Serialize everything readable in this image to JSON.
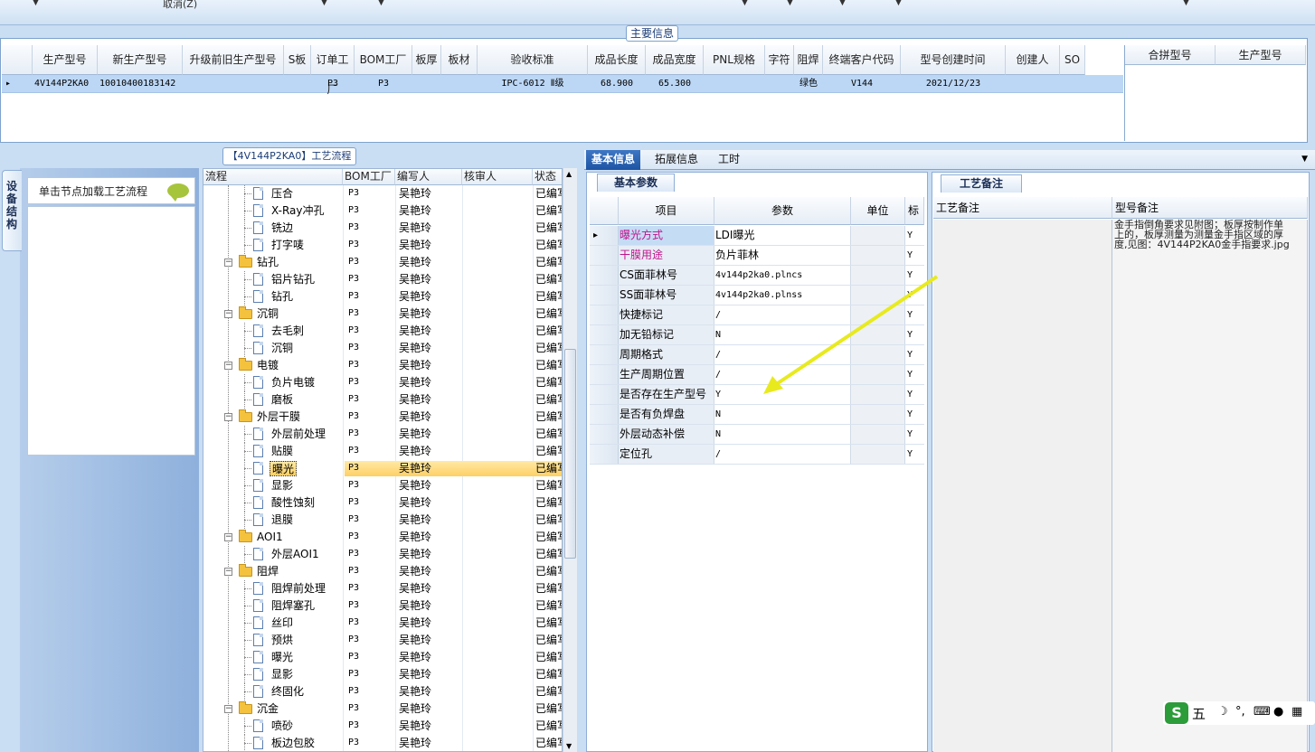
{
  "toolbar": {
    "cancel_label": "取消(Z)"
  },
  "main_info": {
    "legend": "主要信息",
    "columns": [
      "生产型号",
      "新生产型号",
      "升级前旧生产型号",
      "S板",
      "订单工厂",
      "BOM工厂",
      "板厚",
      "板材",
      "验收标准",
      "成品长度",
      "成品宽度",
      "PNL规格",
      "字符",
      "阻焊",
      "终端客户代码",
      "型号创建时间",
      "创建人",
      "SO"
    ],
    "row": [
      "4V144P2KA0",
      "10010400183142",
      "",
      "",
      "P3",
      "P3",
      "",
      "",
      "IPC-6012 Ⅱ级",
      "68.900",
      "65.300",
      "",
      "",
      "绿色",
      "V144",
      "2021/12/23",
      "",
      ""
    ]
  },
  "merge_grid": {
    "columns": [
      "合拼型号",
      "生产型号"
    ]
  },
  "side": {
    "vtab_label": "设备结构",
    "load_hint": "单击节点加载工艺流程"
  },
  "flow": {
    "title": "【4V144P2KA0】工艺流程",
    "columns": [
      "流程",
      "BOM工厂",
      "编写人",
      "核审人",
      "状态"
    ],
    "rows": [
      {
        "name": "压合",
        "type": "file",
        "bom": "P3",
        "writer": "吴艳玲",
        "status": "已编写"
      },
      {
        "name": "X-Ray冲孔",
        "type": "file",
        "bom": "P3",
        "writer": "吴艳玲",
        "status": "已编写"
      },
      {
        "name": "铣边",
        "type": "file",
        "bom": "P3",
        "writer": "吴艳玲",
        "status": "已编写"
      },
      {
        "name": "打字唛",
        "type": "file",
        "bom": "P3",
        "writer": "吴艳玲",
        "status": "已编写"
      },
      {
        "name": "钻孔",
        "type": "folder",
        "bom": "P3",
        "writer": "吴艳玲",
        "status": "已编写"
      },
      {
        "name": "铝片钻孔",
        "type": "file",
        "bom": "P3",
        "writer": "吴艳玲",
        "status": "已编写"
      },
      {
        "name": "钻孔",
        "type": "file",
        "bom": "P3",
        "writer": "吴艳玲",
        "status": "已编写"
      },
      {
        "name": "沉铜",
        "type": "folder",
        "bom": "P3",
        "writer": "吴艳玲",
        "status": "已编写"
      },
      {
        "name": "去毛刺",
        "type": "file",
        "bom": "P3",
        "writer": "吴艳玲",
        "status": "已编写"
      },
      {
        "name": "沉铜",
        "type": "file",
        "bom": "P3",
        "writer": "吴艳玲",
        "status": "已编写"
      },
      {
        "name": "电镀",
        "type": "folder",
        "bom": "P3",
        "writer": "吴艳玲",
        "status": "已编写"
      },
      {
        "name": "负片电镀",
        "type": "file",
        "bom": "P3",
        "writer": "吴艳玲",
        "status": "已编写"
      },
      {
        "name": "磨板",
        "type": "file",
        "bom": "P3",
        "writer": "吴艳玲",
        "status": "已编写"
      },
      {
        "name": "外层干膜",
        "type": "folder",
        "bom": "P3",
        "writer": "吴艳玲",
        "status": "已编写"
      },
      {
        "name": "外层前处理",
        "type": "file",
        "bom": "P3",
        "writer": "吴艳玲",
        "status": "已编写"
      },
      {
        "name": "贴膜",
        "type": "file",
        "bom": "P3",
        "writer": "吴艳玲",
        "status": "已编写"
      },
      {
        "name": "曝光",
        "type": "file",
        "bom": "P3",
        "writer": "吴艳玲",
        "status": "已编写",
        "selected": true
      },
      {
        "name": "显影",
        "type": "file",
        "bom": "P3",
        "writer": "吴艳玲",
        "status": "已编写"
      },
      {
        "name": "酸性蚀刻",
        "type": "file",
        "bom": "P3",
        "writer": "吴艳玲",
        "status": "已编写"
      },
      {
        "name": "退膜",
        "type": "file",
        "bom": "P3",
        "writer": "吴艳玲",
        "status": "已编写"
      },
      {
        "name": "AOI1",
        "type": "folder",
        "bom": "P3",
        "writer": "吴艳玲",
        "status": "已编写"
      },
      {
        "name": "外层AOI1",
        "type": "file",
        "bom": "P3",
        "writer": "吴艳玲",
        "status": "已编写"
      },
      {
        "name": "阻焊",
        "type": "folder",
        "bom": "P3",
        "writer": "吴艳玲",
        "status": "已编写"
      },
      {
        "name": "阻焊前处理",
        "type": "file",
        "bom": "P3",
        "writer": "吴艳玲",
        "status": "已编写"
      },
      {
        "name": "阻焊塞孔",
        "type": "file",
        "bom": "P3",
        "writer": "吴艳玲",
        "status": "已编写"
      },
      {
        "name": "丝印",
        "type": "file",
        "bom": "P3",
        "writer": "吴艳玲",
        "status": "已编写"
      },
      {
        "name": "预烘",
        "type": "file",
        "bom": "P3",
        "writer": "吴艳玲",
        "status": "已编写"
      },
      {
        "name": "曝光",
        "type": "file",
        "bom": "P3",
        "writer": "吴艳玲",
        "status": "已编写"
      },
      {
        "name": "显影",
        "type": "file",
        "bom": "P3",
        "writer": "吴艳玲",
        "status": "已编写"
      },
      {
        "name": "终固化",
        "type": "file",
        "bom": "P3",
        "writer": "吴艳玲",
        "status": "已编写"
      },
      {
        "name": "沉金",
        "type": "folder",
        "bom": "P3",
        "writer": "吴艳玲",
        "status": "已编写"
      },
      {
        "name": "喷砂",
        "type": "file",
        "bom": "P3",
        "writer": "吴艳玲",
        "status": "已编写"
      },
      {
        "name": "板边包胶",
        "type": "file",
        "bom": "P3",
        "writer": "吴艳玲",
        "status": "已编写"
      }
    ]
  },
  "right_tabs": [
    "基本信息",
    "拓展信息",
    "工时"
  ],
  "basic": {
    "tab_label": "基本参数",
    "columns": [
      "项目",
      "参数",
      "单位",
      "标"
    ],
    "rows": [
      {
        "item": "曝光方式",
        "param": "LDI曝光",
        "flag": "Y",
        "highlight": true
      },
      {
        "item": "干膜用途",
        "param": "负片菲林",
        "flag": "Y",
        "highlight": true
      },
      {
        "item": "CS面菲林号",
        "param": "4v144p2ka0.plncs",
        "flag": "Y"
      },
      {
        "item": "SS面菲林号",
        "param": "4v144p2ka0.plnss",
        "flag": "Y"
      },
      {
        "item": "快捷标记",
        "param": "/",
        "flag": "Y"
      },
      {
        "item": "加无铅标记",
        "param": "N",
        "flag": "Y"
      },
      {
        "item": "周期格式",
        "param": "/",
        "flag": "Y"
      },
      {
        "item": "生产周期位置",
        "param": "/",
        "flag": "Y"
      },
      {
        "item": "是否存在生产型号",
        "param": "Y",
        "flag": "Y"
      },
      {
        "item": "是否有负焊盘",
        "param": "N",
        "flag": "Y"
      },
      {
        "item": "外层动态补偿",
        "param": "N",
        "flag": "Y"
      },
      {
        "item": "定位孔",
        "param": "/",
        "flag": "Y"
      }
    ]
  },
  "notes": {
    "tab_label": "工艺备注",
    "col_process": "工艺备注",
    "col_model": "型号备注",
    "model_note": "金手指倒角要求见附图；板厚按制作单上的，板厚测量为测量金手指区域的厚度,见图：4V144P2KA0金手指要求.jpg"
  },
  "ime": {
    "label": "五"
  },
  "colors": {
    "accent": "#1d54a3",
    "highlight_text": "#c0148c",
    "selection": "#fdd065",
    "arrow": "#e8ea1e"
  }
}
